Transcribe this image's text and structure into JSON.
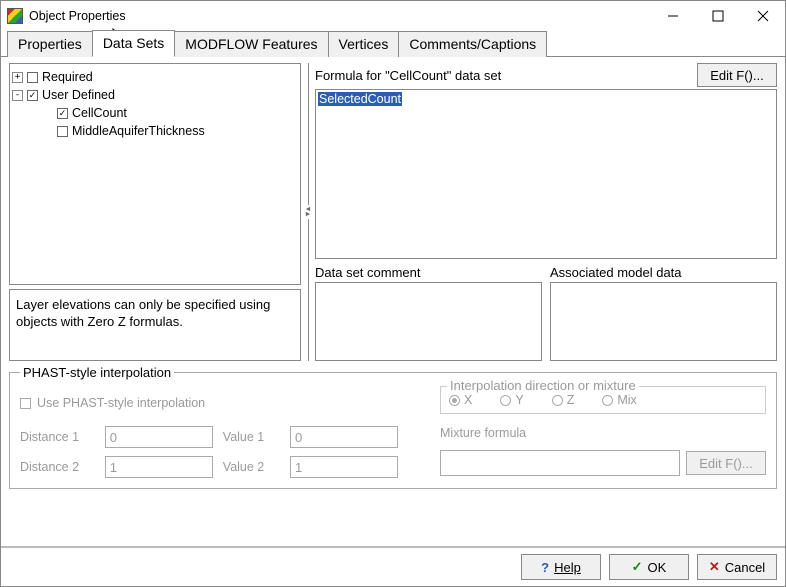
{
  "window": {
    "title": "Object Properties"
  },
  "tabs": [
    {
      "label": "Properties"
    },
    {
      "label": "Data Sets",
      "active": true
    },
    {
      "label": "MODFLOW Features"
    },
    {
      "label": "Vertices"
    },
    {
      "label": "Comments/Captions"
    }
  ],
  "tree": {
    "nodes": [
      {
        "expander": "+",
        "checked": false,
        "label": "Required",
        "indent": 0
      },
      {
        "expander": "-",
        "checked": true,
        "label": "User Defined",
        "indent": 0
      },
      {
        "expander": "",
        "checked": true,
        "label": "CellCount",
        "indent": 1
      },
      {
        "expander": "",
        "checked": false,
        "label": "MiddleAquiferThickness",
        "indent": 1
      }
    ]
  },
  "hint": "Layer elevations can only be specified using objects with Zero Z formulas.",
  "formula": {
    "label": "Formula for \"CellCount\" data set",
    "edit_btn": "Edit F()...",
    "selected_text": "SelectedCount"
  },
  "comment": {
    "label": "Data set comment",
    "value": ""
  },
  "assoc": {
    "label": "Associated model data",
    "value": ""
  },
  "phast": {
    "legend": "PHAST-style interpolation",
    "use_label": "Use PHAST-style interpolation",
    "use_checked": false,
    "d1_label": "Distance 1",
    "d1_value": "0",
    "v1_label": "Value 1",
    "v1_value": "0",
    "d2_label": "Distance 2",
    "d2_value": "1",
    "v2_label": "Value 2",
    "v2_value": "1",
    "dir_legend": "Interpolation direction or mixture",
    "radios": [
      {
        "label": "X",
        "selected": true
      },
      {
        "label": "Y",
        "selected": false
      },
      {
        "label": "Z",
        "selected": false
      },
      {
        "label": "Mix",
        "selected": false
      }
    ],
    "mix_label": "Mixture formula",
    "mix_value": "",
    "mix_edit": "Edit F()..."
  },
  "buttons": {
    "help": "Help",
    "ok": "OK",
    "cancel": "Cancel"
  }
}
